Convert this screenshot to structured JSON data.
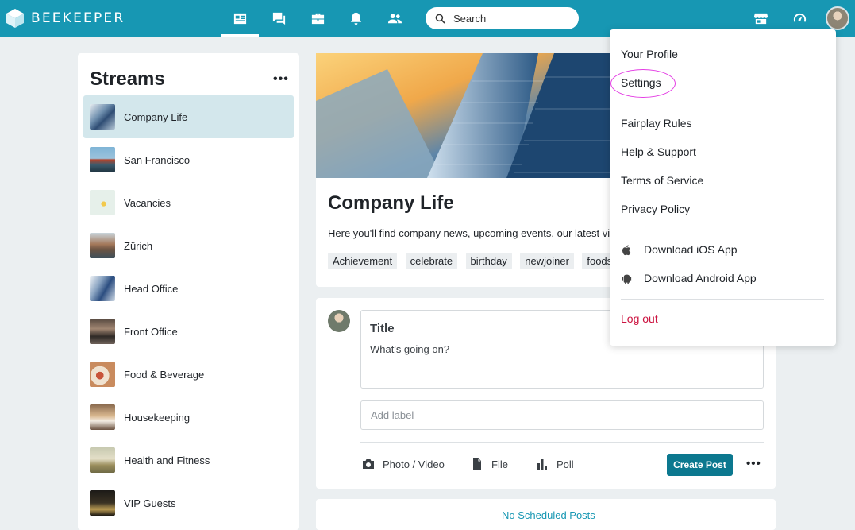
{
  "app": {
    "logo_text": "BEEKEEPER",
    "brand_color": "#1797b3",
    "accent_color": "#0c788f"
  },
  "topnav": {
    "icons": [
      "news-feed-icon",
      "chat-icon",
      "tools-icon",
      "notifications-icon",
      "people-icon"
    ],
    "active": "news-feed-icon",
    "search_placeholder": "Search",
    "right_icons": [
      "store-icon",
      "dashboard-icon"
    ]
  },
  "streams": {
    "title": "Streams",
    "more": "•••",
    "items": [
      {
        "label": "Company Life",
        "active": true
      },
      {
        "label": "San Francisco"
      },
      {
        "label": "Vacancies"
      },
      {
        "label": "Zürich"
      },
      {
        "label": "Head Office"
      },
      {
        "label": "Front Office"
      },
      {
        "label": "Food & Beverage"
      },
      {
        "label": "Housekeeping"
      },
      {
        "label": "Health and Fitness"
      },
      {
        "label": "VIP Guests"
      }
    ]
  },
  "stream_card": {
    "title": "Company Life",
    "description": "Here you'll find company news, upcoming events, our latest vide",
    "tags": [
      "Achievement",
      "celebrate",
      "birthday",
      "newjoiner",
      "foodsa"
    ]
  },
  "composer": {
    "title_placeholder": "Title",
    "body_placeholder": "What's going on?",
    "label_placeholder": "Add label",
    "actions": {
      "photo": "Photo / Video",
      "file": "File",
      "poll": "Poll"
    },
    "create_label": "Create Post",
    "more": "•••"
  },
  "scheduled": "No Scheduled Posts",
  "menu": {
    "items": {
      "profile": "Your Profile",
      "settings": "Settings",
      "fairplay": "Fairplay Rules",
      "help": "Help & Support",
      "terms": "Terms of Service",
      "privacy": "Privacy Policy",
      "ios": "Download iOS App",
      "android": "Download Android App",
      "logout": "Log out"
    },
    "logout_color": "#cc1440",
    "highlight_color": "#e43ee4"
  }
}
